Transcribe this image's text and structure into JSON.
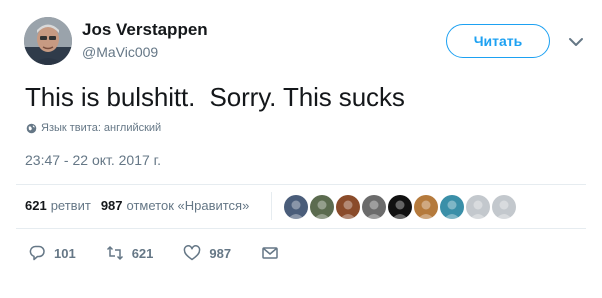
{
  "author": {
    "name": "Jos Verstappen",
    "handle": "@MaVic009"
  },
  "follow_button": {
    "label": "Читать",
    "color": "#1da1f2"
  },
  "tweet": {
    "text": "This is bulshitt.  Sorry. This sucks",
    "language_label": "Язык твита: английский",
    "timestamp": "23:47 - 22 окт. 2017 г."
  },
  "stats": {
    "retweets_count": "621",
    "retweets_label": "ретвит",
    "likes_count": "987",
    "likes_label": "отметок «Нравится»"
  },
  "likers": [
    {
      "name": "liker-avatar-1",
      "color": "#4a5d7a"
    },
    {
      "name": "liker-avatar-2",
      "color": "#5b6b4f"
    },
    {
      "name": "liker-avatar-3",
      "color": "#8a4b2a"
    },
    {
      "name": "liker-avatar-4",
      "color": "#6b6b6b"
    },
    {
      "name": "liker-avatar-5",
      "color": "#111111"
    },
    {
      "name": "liker-avatar-6",
      "color": "#b57a3c"
    },
    {
      "name": "liker-avatar-7",
      "color": "#3a8fa8"
    },
    {
      "name": "liker-avatar-8",
      "color": "#c3c8cd"
    },
    {
      "name": "liker-avatar-9",
      "color": "#c3c8cd"
    }
  ],
  "actions": {
    "reply_count": "101",
    "retweet_count": "621",
    "like_count": "987"
  },
  "icons": {
    "reply": "reply-icon",
    "retweet": "retweet-icon",
    "like": "heart-icon",
    "dm": "envelope-icon",
    "globe": "globe-icon",
    "caret": "chevron-down-icon"
  }
}
